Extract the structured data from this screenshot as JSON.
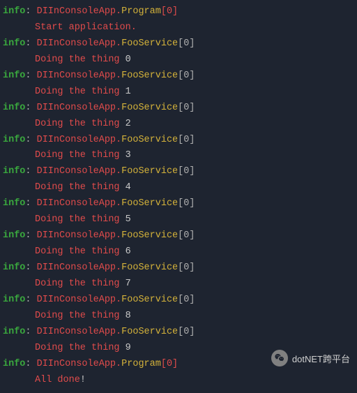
{
  "logs": [
    {
      "level": "info",
      "namespace": "DIInConsoleApp",
      "class": "Program",
      "index": "[0]",
      "message": "Start application.",
      "num": null
    },
    {
      "level": "info",
      "namespace": "DIInConsoleApp",
      "class": "FooService",
      "index": "[0]",
      "message": "Doing the thing ",
      "num": "0"
    },
    {
      "level": "info",
      "namespace": "DIInConsoleApp",
      "class": "FooService",
      "index": "[0]",
      "message": "Doing the thing ",
      "num": "1"
    },
    {
      "level": "info",
      "namespace": "DIInConsoleApp",
      "class": "FooService",
      "index": "[0]",
      "message": "Doing the thing ",
      "num": "2"
    },
    {
      "level": "info",
      "namespace": "DIInConsoleApp",
      "class": "FooService",
      "index": "[0]",
      "message": "Doing the thing ",
      "num": "3"
    },
    {
      "level": "info",
      "namespace": "DIInConsoleApp",
      "class": "FooService",
      "index": "[0]",
      "message": "Doing the thing ",
      "num": "4"
    },
    {
      "level": "info",
      "namespace": "DIInConsoleApp",
      "class": "FooService",
      "index": "[0]",
      "message": "Doing the thing ",
      "num": "5"
    },
    {
      "level": "info",
      "namespace": "DIInConsoleApp",
      "class": "FooService",
      "index": "[0]",
      "message": "Doing the thing ",
      "num": "6"
    },
    {
      "level": "info",
      "namespace": "DIInConsoleApp",
      "class": "FooService",
      "index": "[0]",
      "message": "Doing the thing ",
      "num": "7"
    },
    {
      "level": "info",
      "namespace": "DIInConsoleApp",
      "class": "FooService",
      "index": "[0]",
      "message": "Doing the thing ",
      "num": "8"
    },
    {
      "level": "info",
      "namespace": "DIInConsoleApp",
      "class": "FooService",
      "index": "[0]",
      "message": "Doing the thing ",
      "num": "9"
    },
    {
      "level": "info",
      "namespace": "DIInConsoleApp",
      "class": "Program",
      "index": "[0]",
      "message": "All done",
      "num": null,
      "excl": "!"
    }
  ],
  "watermark": {
    "text": "dotNET跨平台"
  }
}
